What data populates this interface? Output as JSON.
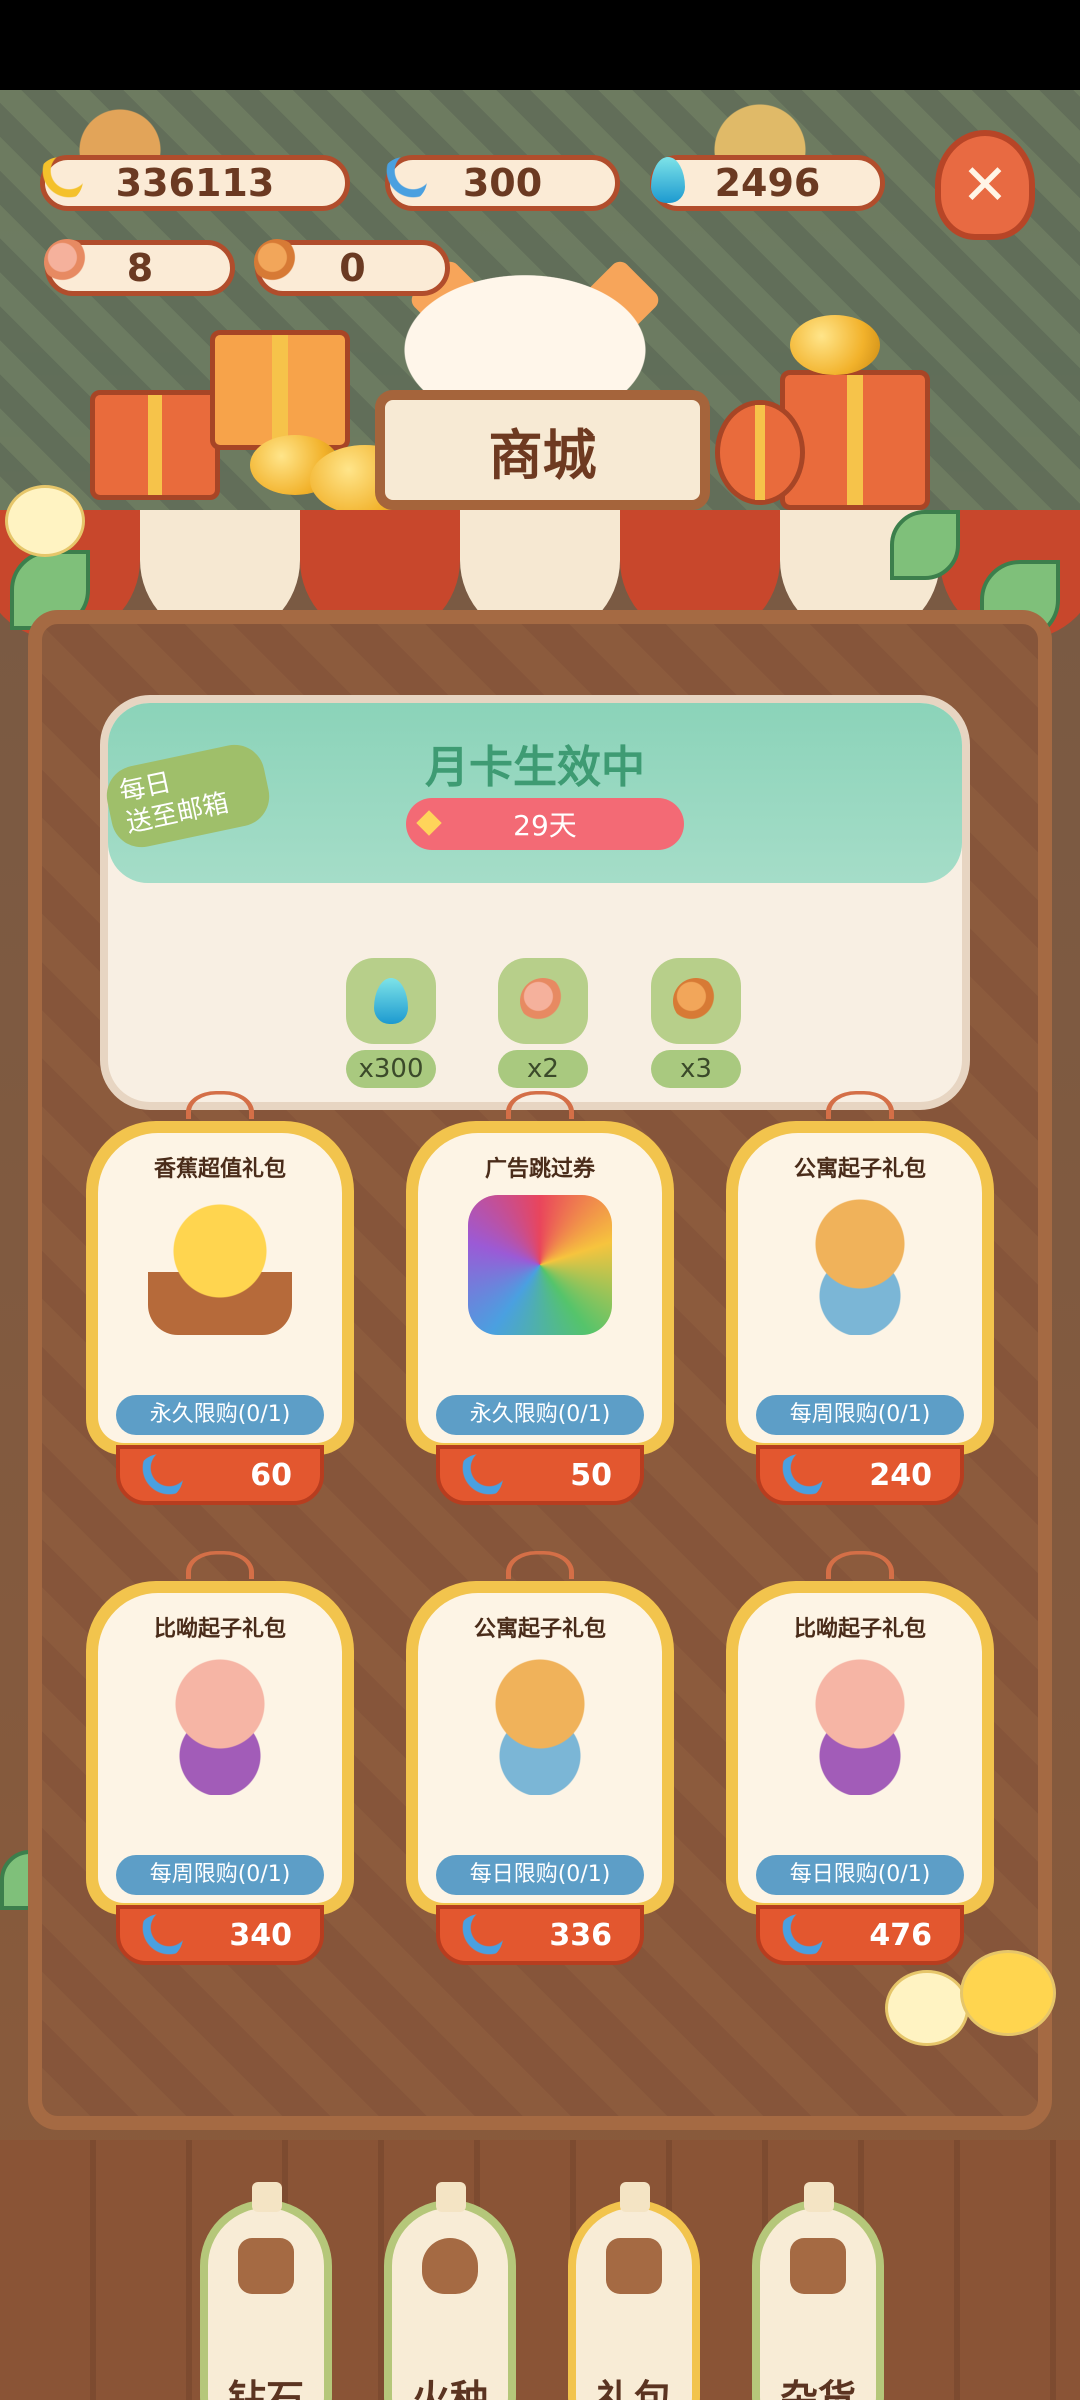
{
  "currencies": {
    "banana": "336113",
    "blue_banana": "300",
    "flame": "2496",
    "bone_paw": "8",
    "bone_orange": "0"
  },
  "shop_title": "商城",
  "month_card": {
    "daily_tag_line1": "每日",
    "daily_tag_line2": "送至邮箱",
    "title": "月卡生效中",
    "days": "29天",
    "rewards": [
      {
        "icon": "flame-icon",
        "qty": "x300"
      },
      {
        "icon": "bone-paw-icon",
        "qty": "x2"
      },
      {
        "icon": "bone-orange-icon",
        "qty": "x3"
      }
    ]
  },
  "items": [
    {
      "title": "香蕉超值礼包",
      "limit": "永久限购(0/1)",
      "price": "60",
      "art": "banana-chest-icon"
    },
    {
      "title": "广告跳过券",
      "limit": "永久限购(0/1)",
      "price": "50",
      "art": "ad-skip-ticket-icon"
    },
    {
      "title": "公寓起子礼包",
      "limit": "每周限购(0/1)",
      "price": "240",
      "art": "paw-bouquet-blue-icon"
    },
    {
      "title": "比呦起子礼包",
      "limit": "每周限购(0/1)",
      "price": "340",
      "art": "paw-bouquet-pink-icon"
    },
    {
      "title": "公寓起子礼包",
      "limit": "每日限购(0/1)",
      "price": "336",
      "art": "paw-bouquet-blue-icon"
    },
    {
      "title": "比呦起子礼包",
      "limit": "每日限购(0/1)",
      "price": "476",
      "art": "paw-bouquet-pink-icon"
    }
  ],
  "tabs": [
    {
      "label": "钻石",
      "icon": "diamond-tab-icon",
      "active": false
    },
    {
      "label": "火种",
      "icon": "flame-tab-icon",
      "active": false
    },
    {
      "label": "礼包",
      "icon": "gift-tab-icon",
      "active": true
    },
    {
      "label": "杂货",
      "icon": "goods-tab-icon",
      "active": false
    }
  ],
  "colors": {
    "accent_red": "#e3572f",
    "card_gold": "#f2c44d",
    "limit_blue": "#5d9ec7",
    "month_green": "#8bd3b9"
  }
}
